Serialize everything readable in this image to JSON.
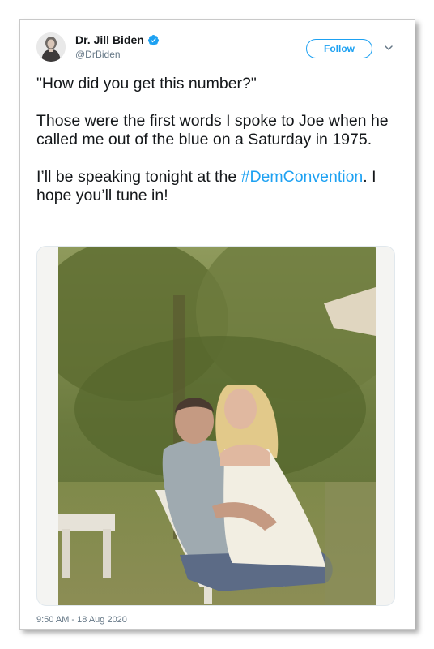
{
  "tweet": {
    "author": {
      "display_name": "Dr. Jill Biden",
      "handle": "@DrBiden",
      "verified": true,
      "avatar_icon": "profile-photo"
    },
    "follow_label": "Follow",
    "menu_icon": "chevron-down-icon",
    "text": {
      "paragraph1": "\"How did you get this number?\"",
      "paragraph2": "Those were the first words I spoke to Joe when he called me out of the blue on a Saturday in 1975.",
      "paragraph3_before": "I’ll be speaking tonight at the ",
      "hashtag": "#DemConvention",
      "paragraph3_after": ". I hope you’ll tune in!"
    },
    "timestamp": "9:50 AM - 18 Aug 2020"
  },
  "colors": {
    "accent": "#1da1f2",
    "text": "#14171a",
    "secondary_text": "#657786"
  }
}
